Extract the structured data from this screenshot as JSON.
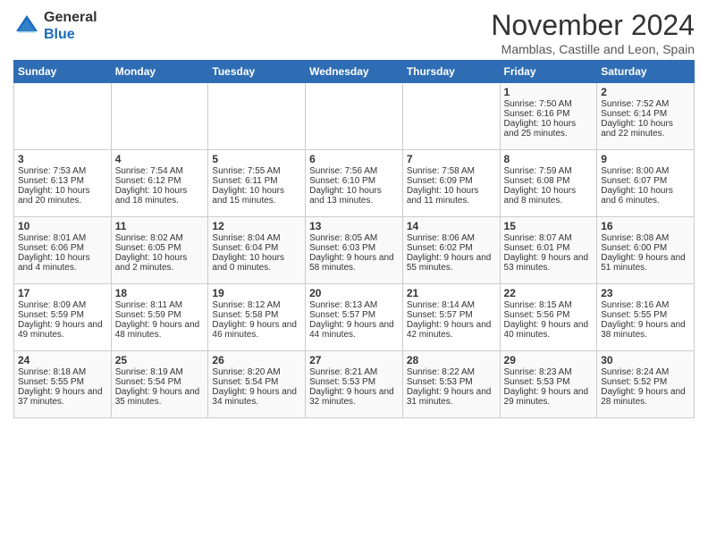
{
  "header": {
    "logo_general": "General",
    "logo_blue": "Blue",
    "month_title": "November 2024",
    "location": "Mamblas, Castille and Leon, Spain"
  },
  "days_of_week": [
    "Sunday",
    "Monday",
    "Tuesday",
    "Wednesday",
    "Thursday",
    "Friday",
    "Saturday"
  ],
  "weeks": [
    [
      {
        "day": "",
        "content": ""
      },
      {
        "day": "",
        "content": ""
      },
      {
        "day": "",
        "content": ""
      },
      {
        "day": "",
        "content": ""
      },
      {
        "day": "",
        "content": ""
      },
      {
        "day": "1",
        "content": "Sunrise: 7:50 AM\nSunset: 6:16 PM\nDaylight: 10 hours and 25 minutes."
      },
      {
        "day": "2",
        "content": "Sunrise: 7:52 AM\nSunset: 6:14 PM\nDaylight: 10 hours and 22 minutes."
      }
    ],
    [
      {
        "day": "3",
        "content": "Sunrise: 7:53 AM\nSunset: 6:13 PM\nDaylight: 10 hours and 20 minutes."
      },
      {
        "day": "4",
        "content": "Sunrise: 7:54 AM\nSunset: 6:12 PM\nDaylight: 10 hours and 18 minutes."
      },
      {
        "day": "5",
        "content": "Sunrise: 7:55 AM\nSunset: 6:11 PM\nDaylight: 10 hours and 15 minutes."
      },
      {
        "day": "6",
        "content": "Sunrise: 7:56 AM\nSunset: 6:10 PM\nDaylight: 10 hours and 13 minutes."
      },
      {
        "day": "7",
        "content": "Sunrise: 7:58 AM\nSunset: 6:09 PM\nDaylight: 10 hours and 11 minutes."
      },
      {
        "day": "8",
        "content": "Sunrise: 7:59 AM\nSunset: 6:08 PM\nDaylight: 10 hours and 8 minutes."
      },
      {
        "day": "9",
        "content": "Sunrise: 8:00 AM\nSunset: 6:07 PM\nDaylight: 10 hours and 6 minutes."
      }
    ],
    [
      {
        "day": "10",
        "content": "Sunrise: 8:01 AM\nSunset: 6:06 PM\nDaylight: 10 hours and 4 minutes."
      },
      {
        "day": "11",
        "content": "Sunrise: 8:02 AM\nSunset: 6:05 PM\nDaylight: 10 hours and 2 minutes."
      },
      {
        "day": "12",
        "content": "Sunrise: 8:04 AM\nSunset: 6:04 PM\nDaylight: 10 hours and 0 minutes."
      },
      {
        "day": "13",
        "content": "Sunrise: 8:05 AM\nSunset: 6:03 PM\nDaylight: 9 hours and 58 minutes."
      },
      {
        "day": "14",
        "content": "Sunrise: 8:06 AM\nSunset: 6:02 PM\nDaylight: 9 hours and 55 minutes."
      },
      {
        "day": "15",
        "content": "Sunrise: 8:07 AM\nSunset: 6:01 PM\nDaylight: 9 hours and 53 minutes."
      },
      {
        "day": "16",
        "content": "Sunrise: 8:08 AM\nSunset: 6:00 PM\nDaylight: 9 hours and 51 minutes."
      }
    ],
    [
      {
        "day": "17",
        "content": "Sunrise: 8:09 AM\nSunset: 5:59 PM\nDaylight: 9 hours and 49 minutes."
      },
      {
        "day": "18",
        "content": "Sunrise: 8:11 AM\nSunset: 5:59 PM\nDaylight: 9 hours and 48 minutes."
      },
      {
        "day": "19",
        "content": "Sunrise: 8:12 AM\nSunset: 5:58 PM\nDaylight: 9 hours and 46 minutes."
      },
      {
        "day": "20",
        "content": "Sunrise: 8:13 AM\nSunset: 5:57 PM\nDaylight: 9 hours and 44 minutes."
      },
      {
        "day": "21",
        "content": "Sunrise: 8:14 AM\nSunset: 5:57 PM\nDaylight: 9 hours and 42 minutes."
      },
      {
        "day": "22",
        "content": "Sunrise: 8:15 AM\nSunset: 5:56 PM\nDaylight: 9 hours and 40 minutes."
      },
      {
        "day": "23",
        "content": "Sunrise: 8:16 AM\nSunset: 5:55 PM\nDaylight: 9 hours and 38 minutes."
      }
    ],
    [
      {
        "day": "24",
        "content": "Sunrise: 8:18 AM\nSunset: 5:55 PM\nDaylight: 9 hours and 37 minutes."
      },
      {
        "day": "25",
        "content": "Sunrise: 8:19 AM\nSunset: 5:54 PM\nDaylight: 9 hours and 35 minutes."
      },
      {
        "day": "26",
        "content": "Sunrise: 8:20 AM\nSunset: 5:54 PM\nDaylight: 9 hours and 34 minutes."
      },
      {
        "day": "27",
        "content": "Sunrise: 8:21 AM\nSunset: 5:53 PM\nDaylight: 9 hours and 32 minutes."
      },
      {
        "day": "28",
        "content": "Sunrise: 8:22 AM\nSunset: 5:53 PM\nDaylight: 9 hours and 31 minutes."
      },
      {
        "day": "29",
        "content": "Sunrise: 8:23 AM\nSunset: 5:53 PM\nDaylight: 9 hours and 29 minutes."
      },
      {
        "day": "30",
        "content": "Sunrise: 8:24 AM\nSunset: 5:52 PM\nDaylight: 9 hours and 28 minutes."
      }
    ]
  ]
}
